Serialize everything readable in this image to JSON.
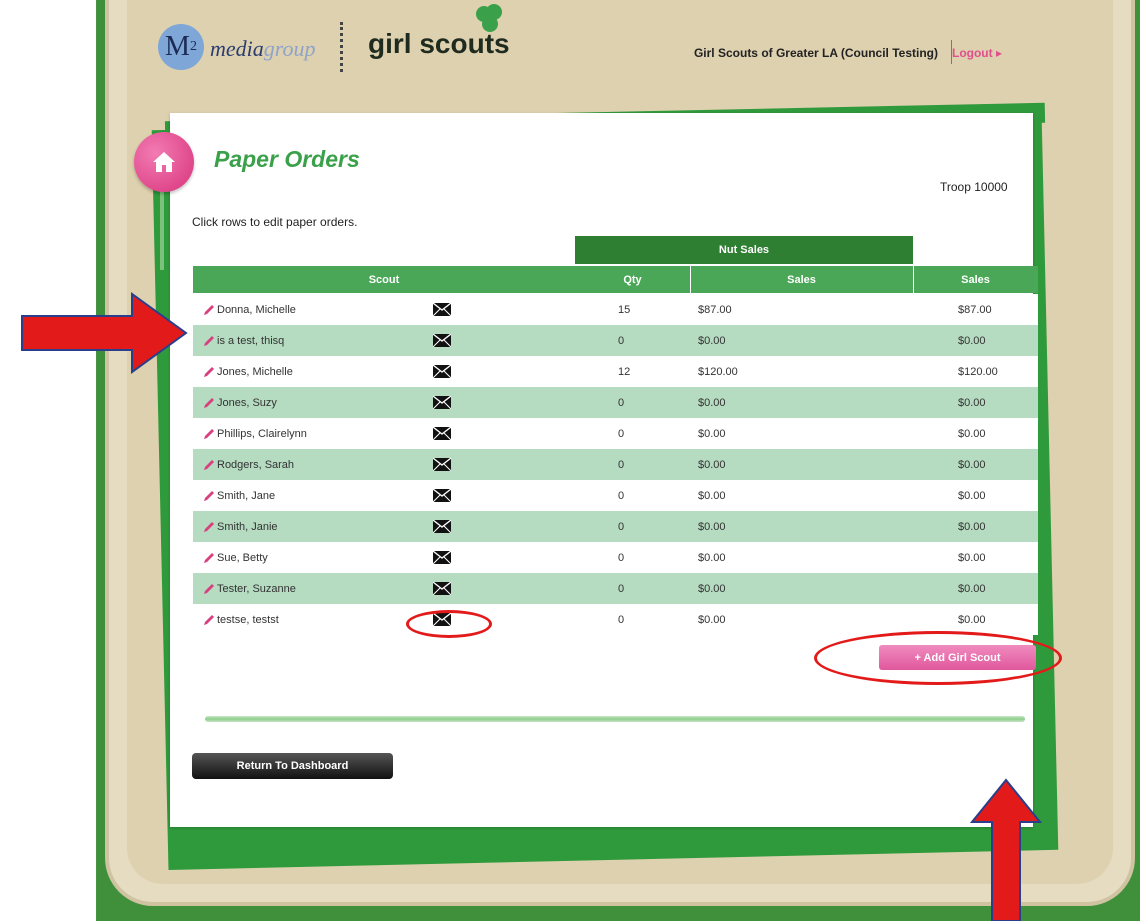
{
  "header": {
    "m2_logo_text": "M",
    "m2_logo_sub": "2",
    "media_text_a": "media",
    "media_text_b": "group",
    "brand_text": "girl scouts",
    "council_name": "Girl Scouts of Greater LA (Council Testing)",
    "logout_label": "Logout ▸"
  },
  "page": {
    "title": "Paper Orders",
    "troop": "Troop 10000",
    "instruction": "Click rows to edit paper orders."
  },
  "table": {
    "group_header": "Nut Sales",
    "columns": [
      "Scout",
      "Qty",
      "Sales",
      "Sales"
    ],
    "rows": [
      {
        "name": "Donna, Michelle",
        "qty": "15",
        "nut_sales": "$87.00",
        "total_sales": "$87.00"
      },
      {
        "name": "is a test, thisq",
        "qty": "0",
        "nut_sales": "$0.00",
        "total_sales": "$0.00"
      },
      {
        "name": "Jones, Michelle",
        "qty": "12",
        "nut_sales": "$120.00",
        "total_sales": "$120.00"
      },
      {
        "name": "Jones, Suzy",
        "qty": "0",
        "nut_sales": "$0.00",
        "total_sales": "$0.00"
      },
      {
        "name": "Phillips, Clairelynn",
        "qty": "0",
        "nut_sales": "$0.00",
        "total_sales": "$0.00"
      },
      {
        "name": "Rodgers, Sarah",
        "qty": "0",
        "nut_sales": "$0.00",
        "total_sales": "$0.00"
      },
      {
        "name": "Smith, Jane",
        "qty": "0",
        "nut_sales": "$0.00",
        "total_sales": "$0.00"
      },
      {
        "name": "Smith, Janie",
        "qty": "0",
        "nut_sales": "$0.00",
        "total_sales": "$0.00"
      },
      {
        "name": "Sue, Betty",
        "qty": "0",
        "nut_sales": "$0.00",
        "total_sales": "$0.00"
      },
      {
        "name": "Tester, Suzanne",
        "qty": "0",
        "nut_sales": "$0.00",
        "total_sales": "$0.00"
      },
      {
        "name": "testse, testst",
        "qty": "0",
        "nut_sales": "$0.00",
        "total_sales": "$0.00"
      }
    ]
  },
  "buttons": {
    "add_scout": "+ Add Girl Scout",
    "return_dashboard": "Return To Dashboard"
  },
  "icons": {
    "home": "home-icon",
    "edit": "pencil-icon",
    "email": "envelope-icon",
    "trefoil": "trefoil-icon"
  },
  "colors": {
    "brand_green": "#4aa757",
    "dark_green": "#2f7f33",
    "row_stripe": "#b5dbc1",
    "accent_pink": "#e0589d",
    "annotation_red": "#e31a1a"
  }
}
